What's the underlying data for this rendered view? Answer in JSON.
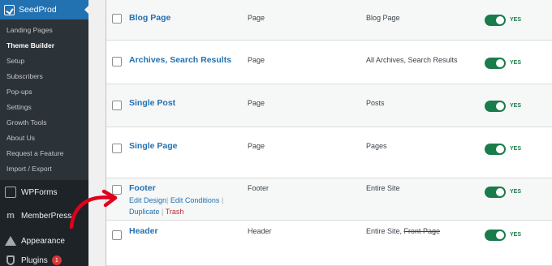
{
  "sidebar": {
    "active_menu": {
      "label": "SeedProd",
      "icon": "seedprod-icon"
    },
    "submenu": [
      {
        "label": "Landing Pages",
        "current": false
      },
      {
        "label": "Theme Builder",
        "current": true
      },
      {
        "label": "Setup",
        "current": false
      },
      {
        "label": "Subscribers",
        "current": false
      },
      {
        "label": "Pop-ups",
        "current": false
      },
      {
        "label": "Settings",
        "current": false
      },
      {
        "label": "Growth Tools",
        "current": false
      },
      {
        "label": "About Us",
        "current": false
      },
      {
        "label": "Request a Feature",
        "current": false
      },
      {
        "label": "Import / Export",
        "current": false
      }
    ],
    "menu_items": [
      {
        "label": "WPForms",
        "icon": "wpforms-icon"
      },
      {
        "label": "MemberPress",
        "icon": "memberpress-icon"
      },
      {
        "label": "Appearance",
        "icon": "appearance-icon"
      },
      {
        "label": "Plugins",
        "icon": "plugins-icon",
        "badge": "1"
      }
    ]
  },
  "templates": {
    "rows": [
      {
        "title": "Blog Page",
        "type": "Page",
        "conditions": "Blog Page",
        "published": true,
        "status_label": "YES"
      },
      {
        "title": "Archives, Search Results",
        "type": "Page",
        "conditions": "All Archives, Search Results",
        "published": true,
        "status_label": "YES"
      },
      {
        "title": "Single Post",
        "type": "Page",
        "conditions": "Posts",
        "published": true,
        "status_label": "YES"
      },
      {
        "title": "Single Page",
        "type": "Page",
        "conditions": "Pages",
        "published": true,
        "status_label": "YES"
      },
      {
        "title": "Footer",
        "type": "Footer",
        "conditions": "Entire Site",
        "published": true,
        "status_label": "YES",
        "row_actions": {
          "edit_design": "Edit Design",
          "edit_conditions": "Edit Conditions",
          "duplicate": "Duplicate",
          "trash": "Trash",
          "separator": "|"
        }
      },
      {
        "title": "Header",
        "type": "Header",
        "conditions": "Entire Site, ",
        "conditions_struck": "Front Page",
        "published": true,
        "status_label": "YES"
      }
    ]
  },
  "colors": {
    "sidebar_bg": "#1d2327",
    "active_menu_bg": "#2271b1",
    "link_blue": "#2271b1",
    "toggle_green": "#1a7c4b",
    "trash_red": "#b32d2e",
    "annotation_arrow": "#e0001b"
  }
}
